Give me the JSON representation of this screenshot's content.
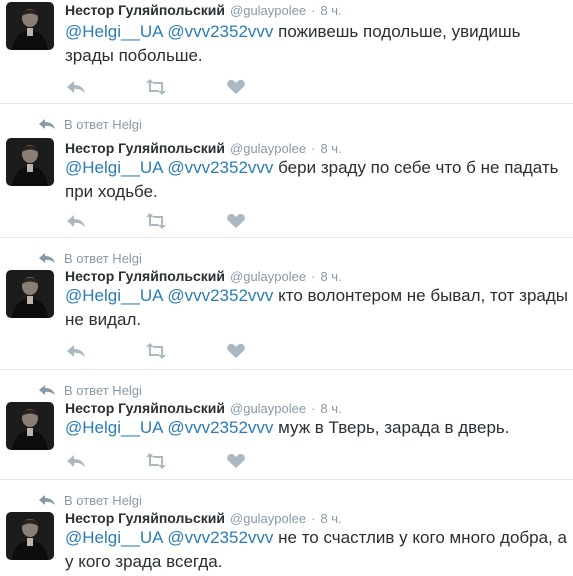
{
  "tweets": [
    {
      "reply_context": "",
      "name": "Нестор Гуляйпольский",
      "handle": "@gulaypolee",
      "separator": "·",
      "time": "8 ч.",
      "mention1": "@Helgi__UA",
      "mention2": "@vvv2352vvv",
      "text": "поживешь подольше, увидишь зрады побольше.",
      "icons": [
        "reply-icon",
        "retweet-icon",
        "heart-icon"
      ]
    },
    {
      "reply_context": "В ответ Helgi",
      "name": "Нестор Гуляйпольский",
      "handle": "@gulaypolee",
      "separator": "·",
      "time": "8 ч.",
      "mention1": "@Helgi__UA",
      "mention2": "@vvv2352vvv",
      "text": "бери зраду по себе что б не падать при ходьбе.",
      "icons": [
        "reply-icon",
        "retweet-icon",
        "heart-icon"
      ]
    },
    {
      "reply_context": "В ответ Helgi",
      "name": "Нестор Гуляйпольский",
      "handle": "@gulaypolee",
      "separator": "·",
      "time": "8 ч.",
      "mention1": "@Helgi__UA",
      "mention2": "@vvv2352vvv",
      "text": " кто волонтером не бывал, тот зрады не видал.",
      "icons": [
        "reply-icon",
        "retweet-icon",
        "heart-icon"
      ]
    },
    {
      "reply_context": "В ответ Helgi",
      "name": "Нестор Гуляйпольский",
      "handle": "@gulaypolee",
      "separator": "·",
      "time": "8 ч.",
      "mention1": "@Helgi__UA",
      "mention2": "@vvv2352vvv",
      "text": "муж в Тверь, зарада в дверь.",
      "icons": [
        "reply-icon",
        "retweet-icon",
        "heart-icon"
      ]
    },
    {
      "reply_context": "В ответ Helgi",
      "name": "Нестор Гуляйпольский",
      "handle": "@gulaypolee",
      "separator": "·",
      "time": "8 ч.",
      "mention1": "@Helgi__UA",
      "mention2": "@vvv2352vvv",
      "text": "не то счастлив у кого много добра, а у кого зрада всегда.",
      "icons": [
        "reply-icon",
        "retweet-icon",
        "heart-icon"
      ]
    }
  ],
  "colors": {
    "mention": "#2b7bb9",
    "muted": "#8899a6",
    "text": "#292f33",
    "divider": "#e1e8ed",
    "action_icon": "#aab8c2"
  }
}
